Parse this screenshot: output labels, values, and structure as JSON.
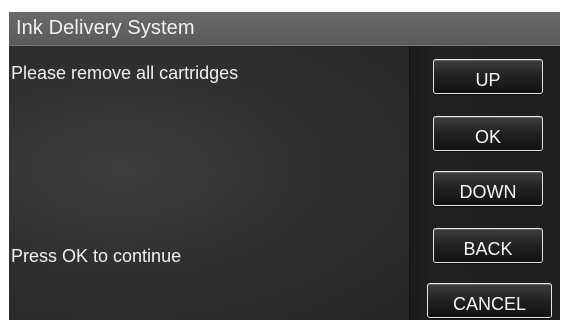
{
  "header": {
    "title": "Ink Delivery System"
  },
  "main": {
    "message_top": "Please remove all cartridges",
    "message_bottom": "Press OK to continue"
  },
  "buttons": {
    "up": "UP",
    "ok": "OK",
    "down": "DOWN",
    "back": "BACK",
    "cancel": "CANCEL"
  },
  "colors": {
    "title_bar": "#5f5f5f",
    "panel_background": "#2f2f2f",
    "button_border": "#e5e5e5",
    "text": "#f0f0f0"
  }
}
